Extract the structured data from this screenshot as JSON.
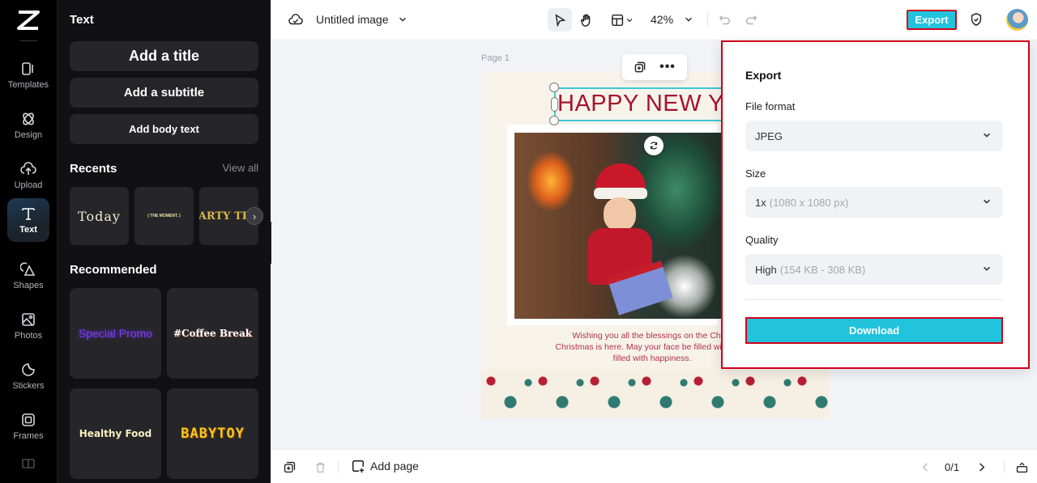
{
  "rail": {
    "items": [
      {
        "label": "Templates",
        "icon": "templates-icon"
      },
      {
        "label": "Design",
        "icon": "design-icon"
      },
      {
        "label": "Upload",
        "icon": "upload-icon"
      },
      {
        "label": "Text",
        "icon": "text-icon",
        "active": true
      },
      {
        "label": "Shapes",
        "icon": "shapes-icon"
      },
      {
        "label": "Photos",
        "icon": "photos-icon"
      },
      {
        "label": "Stickers",
        "icon": "stickers-icon"
      },
      {
        "label": "Frames",
        "icon": "frames-icon"
      }
    ]
  },
  "panel": {
    "title": "Text",
    "add_title": "Add a title",
    "add_subtitle": "Add a subtitle",
    "add_body": "Add body text",
    "recents_title": "Recents",
    "view_all": "View all",
    "recents": [
      "Today",
      "( THE MOMENT. )",
      "PARTY TIME"
    ],
    "recommended_title": "Recommended",
    "recommended": [
      "Special Promo",
      "#Coffee Break",
      "Healthy Food",
      "BABYTOY"
    ]
  },
  "topbar": {
    "doc_title": "Untitled image",
    "zoom": "42%",
    "export_label": "Export"
  },
  "canvas": {
    "page_label": "Page 1",
    "headline": "HAPPY NEW YE",
    "wish_lines": [
      "Wishing you all the blessings on the Christ",
      "Christmas is here. May your face be filled with joy a",
      "filled with happiness."
    ]
  },
  "export_panel": {
    "title": "Export",
    "file_format_label": "File format",
    "file_format_value": "JPEG",
    "size_label": "Size",
    "size_value": "1x",
    "size_detail": "(1080 x 1080 px)",
    "quality_label": "Quality",
    "quality_value": "High",
    "quality_detail": "(154 KB - 308 KB)",
    "download_label": "Download"
  },
  "bottombar": {
    "add_page": "Add page",
    "page_count": "0/1"
  },
  "colors": {
    "accent": "#22c3dc",
    "highlight": "#d0021b",
    "headline": "#a6122e"
  }
}
